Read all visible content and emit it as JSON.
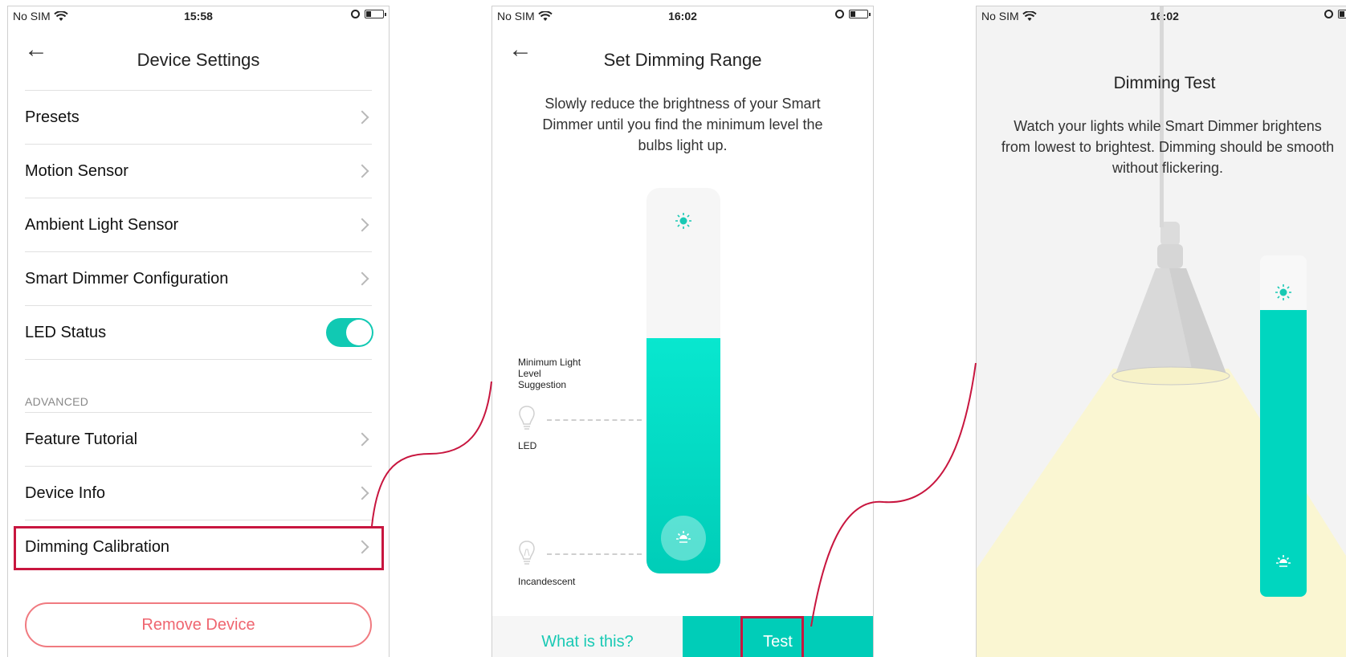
{
  "phone1": {
    "status": {
      "carrier": "No SIM",
      "time": "15:58"
    },
    "title": "Device Settings",
    "items": [
      {
        "label": "Presets"
      },
      {
        "label": "Motion Sensor"
      },
      {
        "label": "Ambient Light Sensor"
      },
      {
        "label": "Smart Dimmer Configuration"
      },
      {
        "label": "LED Status",
        "toggle_on": true
      }
    ],
    "section_label": "ADVANCED",
    "advanced_items": [
      {
        "label": "Feature Tutorial"
      },
      {
        "label": "Device Info"
      },
      {
        "label": "Dimming Calibration"
      }
    ],
    "remove_label": "Remove Device"
  },
  "phone2": {
    "status": {
      "carrier": "No SIM",
      "time": "16:02"
    },
    "title": "Set Dimming Range",
    "description": "Slowly reduce the brightness of your Smart Dimmer until you find the minimum level the bulbs light up.",
    "suggestion_label": "Minimum Light Level Suggestion",
    "led_label": "LED",
    "incandescent_label": "Incandescent",
    "brightness_level": 0.61,
    "what_label": "What is this?",
    "test_label": "Test"
  },
  "phone3": {
    "status": {
      "carrier": "No SIM",
      "time": "16:02"
    },
    "title": "Dimming Test",
    "description": "Watch your lights while Smart Dimmer brightens from lowest to brightest. Dimming should be smooth without flickering.",
    "brightness_level": 0.84
  },
  "colors": {
    "accent": "#00cdb8",
    "highlight": "#c8163f",
    "remove": "#ef6670"
  }
}
